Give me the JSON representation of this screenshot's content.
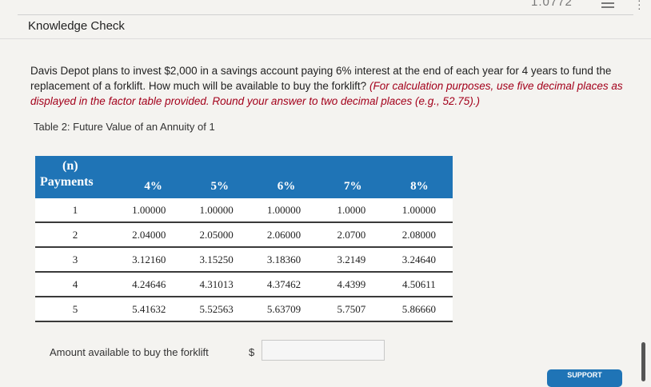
{
  "topbar": {
    "counter": "1.0772",
    "list_icon": "list-icon",
    "more_icon": "more-vertical-icon"
  },
  "header": {
    "title": "Knowledge Check"
  },
  "question": {
    "text": "Davis Depot plans to invest $2,000 in a savings account paying 6% interest at the end of each year for 4 years to fund the replacement of a forklift. How much will be available to buy the forklift?",
    "hint": "(For calculation purposes, use five decimal places as displayed in the factor table provided. Round your answer to two decimal places (e.g., 52.75).)"
  },
  "table": {
    "caption": "Table 2: Future Value of an Annuity of 1",
    "header_n_line1": "(n)",
    "header_n_line2": "Payments",
    "rates": [
      "4%",
      "5%",
      "6%",
      "7%",
      "8%"
    ],
    "rows": [
      {
        "n": "1",
        "values": [
          "1.00000",
          "1.00000",
          "1.00000",
          "1.0000",
          "1.00000"
        ]
      },
      {
        "n": "2",
        "values": [
          "2.04000",
          "2.05000",
          "2.06000",
          "2.0700",
          "2.08000"
        ]
      },
      {
        "n": "3",
        "values": [
          "3.12160",
          "3.15250",
          "3.18360",
          "3.2149",
          "3.24640"
        ]
      },
      {
        "n": "4",
        "values": [
          "4.24646",
          "4.31013",
          "4.37462",
          "4.4399",
          "4.50611"
        ]
      },
      {
        "n": "5",
        "values": [
          "5.41632",
          "5.52563",
          "5.63709",
          "5.7507",
          "5.86660"
        ]
      }
    ]
  },
  "answer": {
    "label": "Amount available to buy the forklift",
    "currency": "$",
    "value": ""
  },
  "support": {
    "label": "SUPPORT"
  },
  "colors": {
    "table_header": "#1f74b6",
    "hint": "#a3001b"
  }
}
